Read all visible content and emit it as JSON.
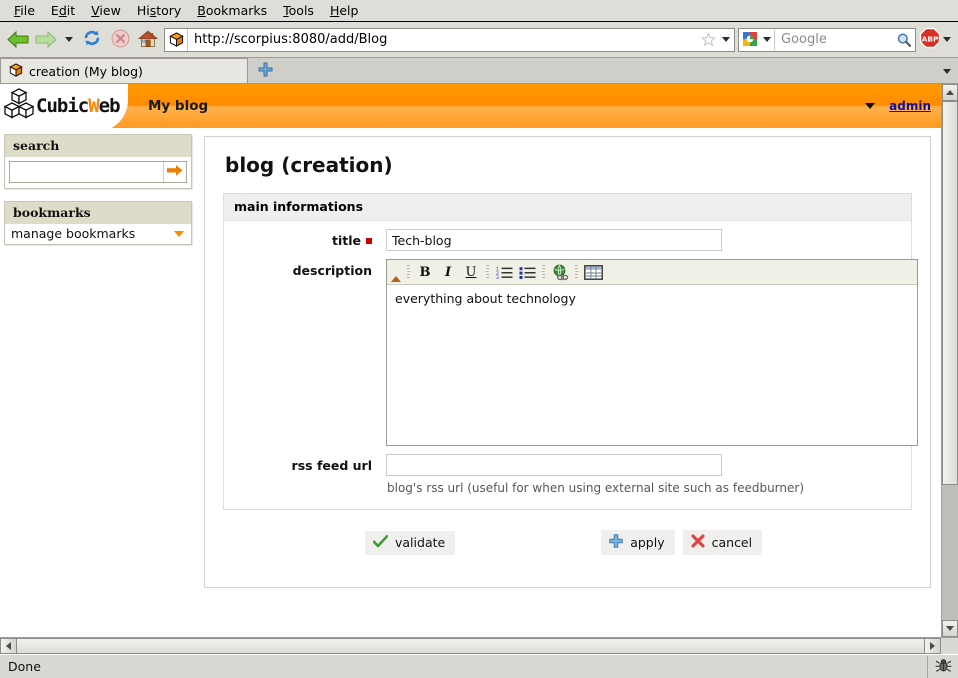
{
  "browser": {
    "menu": [
      {
        "label": "File",
        "accel": "F"
      },
      {
        "label": "Edit",
        "accel": "E"
      },
      {
        "label": "View",
        "accel": "V"
      },
      {
        "label": "History",
        "accel": "s"
      },
      {
        "label": "Bookmarks",
        "accel": "B"
      },
      {
        "label": "Tools",
        "accel": "T"
      },
      {
        "label": "Help",
        "accel": "H"
      }
    ],
    "nav": {
      "back_icon": "back-arrow-icon",
      "forward_icon": "forward-arrow-icon",
      "dropdown_icon": "chevron-down-icon",
      "reload_icon": "reload-icon",
      "stop_icon": "stop-icon",
      "home_icon": "home-icon"
    },
    "url": "http://scorpius:8080/add/Blog",
    "url_favicon": "cube-favicon",
    "bookmark_star_icon": "star-icon",
    "search": {
      "engine": "google-engine-icon",
      "placeholder": "Google",
      "magnifier_icon": "magnifier-icon"
    },
    "adblock_label": "ABP",
    "tab": {
      "title": "creation (My blog)",
      "favicon": "cube-favicon",
      "new_tab_icon": "plus-icon",
      "tab_list_icon": "chevron-down-icon"
    },
    "status": {
      "text": "Done",
      "icon": "firebug-bug-icon"
    }
  },
  "app": {
    "logo_text_before": "Cubic",
    "logo_text_o": "W",
    "logo_text_after": "eb",
    "logo_full": "CubicWeb",
    "title": "My blog",
    "user": "admin",
    "user_menu_icon": "chevron-down-icon"
  },
  "sidebar": {
    "boxes": [
      {
        "title": "search",
        "type": "search",
        "input_value": "",
        "input_placeholder": "",
        "go_icon": "arrow-right-icon"
      },
      {
        "title": "bookmarks",
        "type": "menu",
        "item_label": "manage bookmarks",
        "caret_icon": "caret-down-icon"
      }
    ]
  },
  "main": {
    "page_title": "blog (creation)",
    "fieldset_legend": "main informations",
    "fields": [
      {
        "label": "title",
        "required": true,
        "type": "text",
        "value": "Tech-blog",
        "help": ""
      },
      {
        "label": "description",
        "required": false,
        "type": "richtext",
        "value": "everything about technology",
        "help": ""
      },
      {
        "label": "rss feed url",
        "required": false,
        "type": "text",
        "value": "",
        "help": "blog's rss url (useful for when using external site such as feedburner)"
      }
    ],
    "editor_toolbar": [
      {
        "name": "collapse-icon",
        "glyph": ""
      },
      {
        "name": "bold-button",
        "glyph": "B"
      },
      {
        "name": "italic-button",
        "glyph": "I"
      },
      {
        "name": "underline-button",
        "glyph": "U"
      },
      {
        "name": "ordered-list-button",
        "glyph": ""
      },
      {
        "name": "unordered-list-button",
        "glyph": ""
      },
      {
        "name": "insert-link-button",
        "glyph": ""
      },
      {
        "name": "insert-table-button",
        "glyph": ""
      }
    ],
    "actions": [
      {
        "label": "validate",
        "icon": "check-icon",
        "color": "#3f9c35"
      },
      {
        "label": "apply",
        "icon": "plus-icon",
        "color": "#4a90d9"
      },
      {
        "label": "cancel",
        "icon": "cross-icon",
        "color": "#d94040"
      }
    ]
  },
  "colors": {
    "brand_orange": "#ff8c00",
    "required_red": "#cc0000",
    "link_blue": "#11119a"
  }
}
